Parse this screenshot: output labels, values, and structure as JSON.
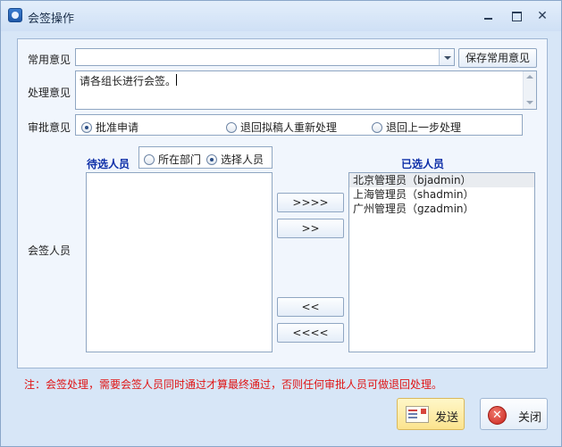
{
  "window": {
    "title": "会签操作",
    "close_glyph": "✕"
  },
  "form": {
    "common_opinion": {
      "label": "常用意见",
      "value": "",
      "save_button": "保存常用意见"
    },
    "processing_opinion": {
      "label": "处理意见",
      "value": "请各组长进行会签。"
    },
    "approval": {
      "label": "审批意见",
      "options": [
        {
          "label": "批准申请",
          "selected": true
        },
        {
          "label": "退回拟稿人重新处理",
          "selected": false
        },
        {
          "label": "退回上一步处理",
          "selected": false
        }
      ]
    }
  },
  "countersign": {
    "label": "会签人员",
    "candidates_title": "待选人员",
    "selected_title": "已选人员",
    "source_options": [
      {
        "label": "所在部门",
        "selected": false
      },
      {
        "label": "选择人员",
        "selected": true
      }
    ],
    "candidates": [],
    "selected": [
      "北京管理员（bjadmin）",
      "上海管理员（shadmin）",
      "广州管理员（gzadmin）"
    ],
    "buttons": {
      "add_all": ">>>>",
      "add": ">>",
      "remove": "<<",
      "remove_all": "<<<<"
    }
  },
  "note": "注：会签处理，需要会签人员同时通过才算最终通过，否则任何审批人员可做退回处理。",
  "actions": {
    "send": "发送",
    "close": "关闭"
  },
  "colors": {
    "note": "#e01414",
    "list_heading": "#0e2fa8",
    "send_button": "#fbe38e"
  }
}
